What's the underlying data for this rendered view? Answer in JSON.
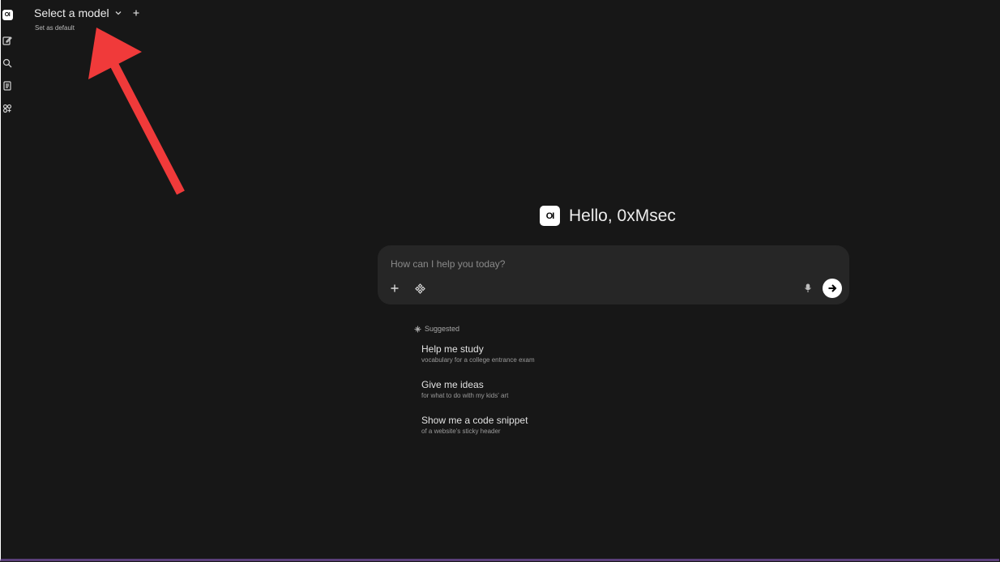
{
  "header": {
    "model_selector_label": "Select a model",
    "set_default_label": "Set as default"
  },
  "sidebar": {
    "logo_text": "OI",
    "items": [
      {
        "icon": "new-chat-icon"
      },
      {
        "icon": "search-icon"
      },
      {
        "icon": "notes-icon"
      },
      {
        "icon": "workspace-icon"
      }
    ]
  },
  "greeting": {
    "logo_text": "OI",
    "text": "Hello, 0xMsec"
  },
  "chat": {
    "placeholder": "How can I help you today?"
  },
  "suggested": {
    "label": "Suggested",
    "items": [
      {
        "title": "Help me study",
        "subtitle": "vocabulary for a college entrance exam"
      },
      {
        "title": "Give me ideas",
        "subtitle": "for what to do with my kids' art"
      },
      {
        "title": "Show me a code snippet",
        "subtitle": "of a website's sticky header"
      }
    ]
  },
  "colors": {
    "background": "#171717",
    "input_background": "#262626",
    "annotation_arrow": "#f03a3a"
  }
}
